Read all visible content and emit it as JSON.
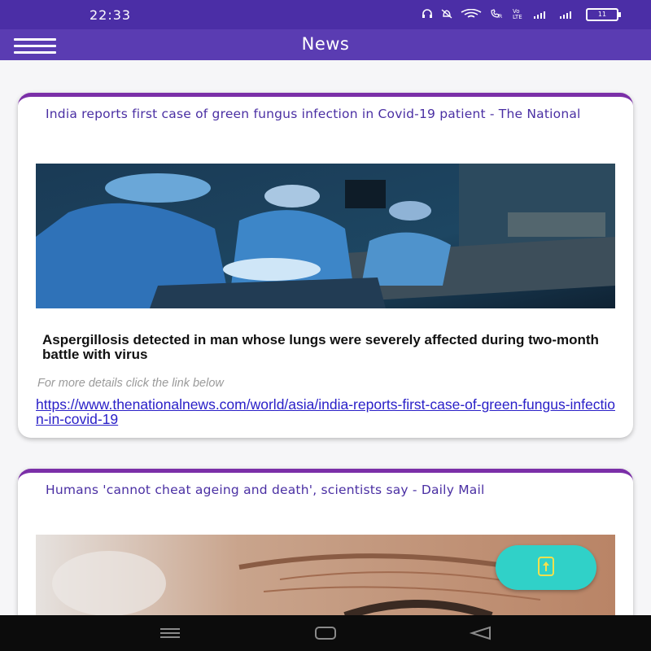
{
  "status_bar": {
    "time": "22:33",
    "battery_level": "11",
    "volte_label": "Vo LTE"
  },
  "app_bar": {
    "title": "News"
  },
  "articles": [
    {
      "headline": "India reports first case of green fungus infection in Covid-19 patient - The National",
      "image_icon": "surgeons-operating-image",
      "summary": "Aspergillosis detected in man whose lungs were severely affected during two-month battle with virus",
      "hint": "For more details click the link below",
      "link": "https://www.thenationalnews.com/world/asia/india-reports-first-case-of-green-fungus-infection-in-covid-19"
    },
    {
      "headline": "Humans 'cannot cheat ageing and death', scientists say - Daily Mail",
      "image_icon": "aged-skin-closeup-image"
    }
  ],
  "colors": {
    "status_bar": "#4b2ea6",
    "app_bar": "#5a3cb2",
    "card_accent": "#7b2fa8",
    "headline": "#4a2fa3",
    "link": "#2a20c8",
    "fab": "#30d1c8",
    "fab_icon": "#f4e04d"
  },
  "fab": {
    "icon": "scroll-up-icon"
  },
  "nav_bar": {
    "items": [
      "menu-icon",
      "home-icon",
      "back-icon"
    ]
  }
}
